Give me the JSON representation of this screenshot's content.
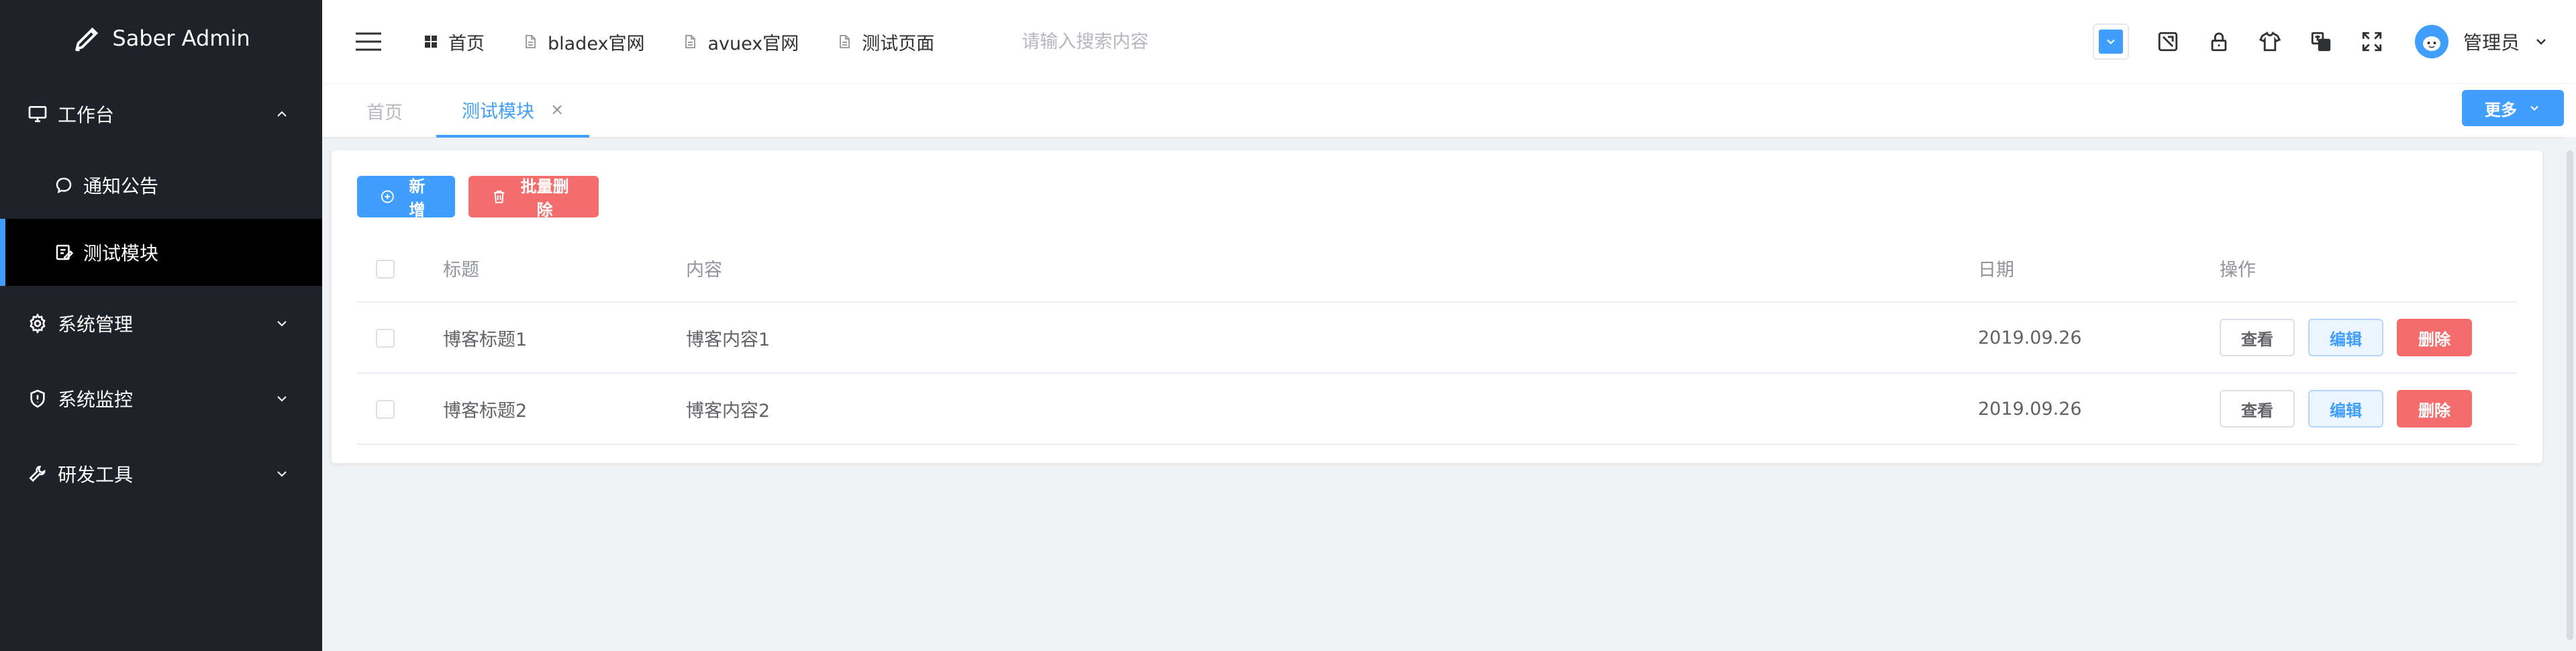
{
  "app": {
    "logo_text": "Saber Admin"
  },
  "sidebar": {
    "groups": [
      {
        "label": "工作台",
        "icon": "monitor-icon",
        "expanded": true,
        "items": [
          {
            "label": "通知公告",
            "icon": "chat-bubble-icon",
            "active": false
          },
          {
            "label": "测试模块",
            "icon": "edit-icon",
            "active": true
          }
        ]
      },
      {
        "label": "系统管理",
        "icon": "gear-icon",
        "expanded": false
      },
      {
        "label": "系统监控",
        "icon": "shield-icon",
        "expanded": false
      },
      {
        "label": "研发工具",
        "icon": "wrench-icon",
        "expanded": false
      }
    ]
  },
  "header": {
    "nav": [
      {
        "label": "首页",
        "icon": "grid-icon"
      },
      {
        "label": "bladex官网",
        "icon": "document-icon"
      },
      {
        "label": "avuex官网",
        "icon": "document-icon"
      },
      {
        "label": "测试页面",
        "icon": "document-icon"
      }
    ],
    "search": {
      "placeholder": "请输入搜索内容",
      "value": ""
    },
    "icons": [
      "color-picker-icon",
      "screenshot-icon",
      "lock-icon",
      "shirt-icon",
      "translate-icon",
      "fullscreen-icon"
    ],
    "user": {
      "name": "管理员"
    }
  },
  "tags": {
    "items": [
      {
        "label": "首页",
        "active": false
      },
      {
        "label": "测试模块",
        "active": true,
        "closable": true
      }
    ],
    "close_glyph": "×",
    "more_label": "更多"
  },
  "toolbar": {
    "add_label": "新增",
    "batch_delete_label": "批量删除"
  },
  "table": {
    "columns": [
      "标题",
      "内容",
      "日期",
      "操作"
    ],
    "rows": [
      {
        "title": "博客标题1",
        "content": "博客内容1",
        "date": "2019.09.26"
      },
      {
        "title": "博客标题2",
        "content": "博客内容2",
        "date": "2019.09.26"
      }
    ],
    "actions": {
      "view": "查看",
      "edit": "编辑",
      "delete": "删除"
    }
  },
  "colors": {
    "sidebar_bg": "#20222a",
    "active_item_bg": "#000000",
    "primary": "#409eff",
    "danger": "#f56c6c",
    "page_bg": "#f0f2f5"
  }
}
